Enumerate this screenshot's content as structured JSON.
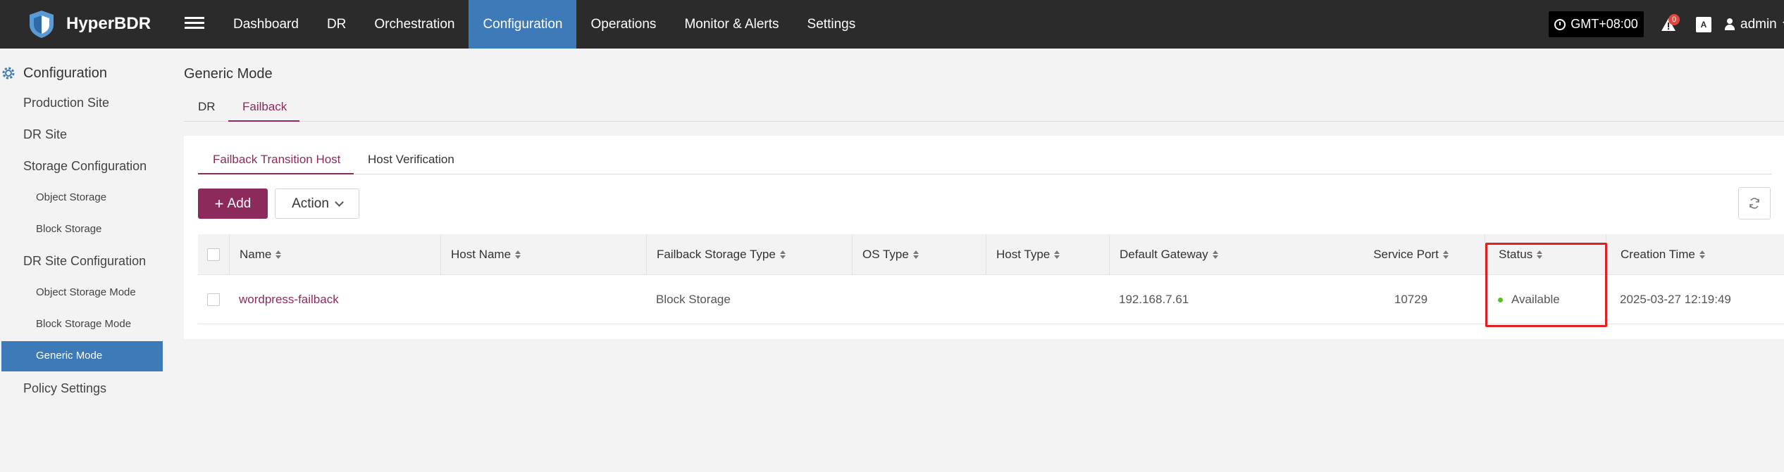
{
  "brand": {
    "name": "HyperBDR"
  },
  "nav": [
    {
      "label": "Dashboard"
    },
    {
      "label": "DR"
    },
    {
      "label": "Orchestration"
    },
    {
      "label": "Configuration"
    },
    {
      "label": "Operations"
    },
    {
      "label": "Monitor & Alerts"
    },
    {
      "label": "Settings"
    }
  ],
  "header": {
    "timezone": "GMT+08:00",
    "alert_count": "0",
    "lang_icon": "A",
    "user": "admin"
  },
  "sidebar": {
    "title": "Configuration",
    "items": [
      {
        "label": "Production Site"
      },
      {
        "label": "DR Site"
      },
      {
        "label": "Storage Configuration"
      },
      {
        "label": "Object Storage"
      },
      {
        "label": "Block Storage"
      },
      {
        "label": "DR Site Configuration"
      },
      {
        "label": "Object Storage Mode"
      },
      {
        "label": "Block Storage Mode"
      },
      {
        "label": "Generic Mode"
      },
      {
        "label": "Policy Settings"
      }
    ]
  },
  "main": {
    "title": "Generic Mode",
    "tabs": [
      {
        "label": "DR"
      },
      {
        "label": "Failback"
      }
    ],
    "subtabs": [
      {
        "label": "Failback Transition Host"
      },
      {
        "label": "Host Verification"
      }
    ],
    "add_label": "Add",
    "action_label": "Action"
  },
  "table": {
    "columns": [
      "Name",
      "Host Name",
      "Failback Storage Type",
      "OS Type",
      "Host Type",
      "Default Gateway",
      "Service Port",
      "Status",
      "Creation Time"
    ],
    "rows": [
      {
        "name": "wordpress-failback",
        "host_name": "",
        "storage_type": "Block Storage",
        "os_type": "",
        "host_type": "",
        "gateway": "192.168.7.61",
        "port": "10729",
        "status": "Available",
        "created": "2025-03-27 12:19:49"
      }
    ]
  },
  "colors": {
    "topbar": "#2b2b2b",
    "nav_active": "#3d7ab7",
    "accent": "#8c2a5c",
    "status_ok": "#52c41a",
    "highlight": "#e02020"
  }
}
